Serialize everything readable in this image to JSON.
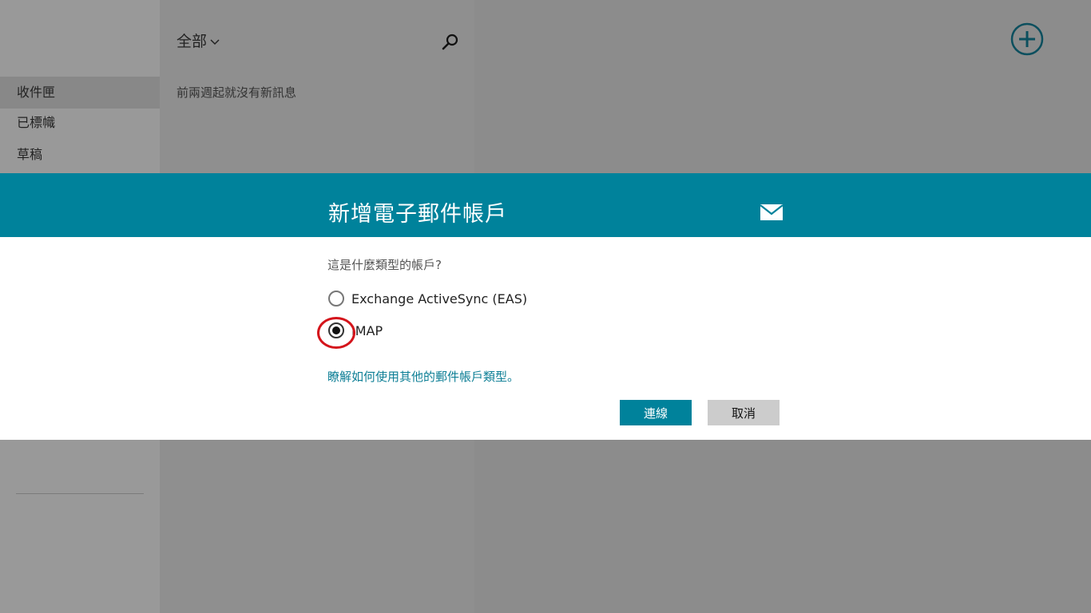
{
  "sidebar": {
    "folders": [
      {
        "label": "收件匣",
        "selected": true
      },
      {
        "label": "已標幟",
        "selected": false
      },
      {
        "label": "草稿",
        "selected": false
      }
    ]
  },
  "message_list": {
    "filter_label": "全部",
    "empty_message": "前兩週起就沒有新訊息"
  },
  "icons": {
    "search": "search-icon",
    "add": "add-icon",
    "mail": "mail-icon",
    "chevron": "chevron-down-icon"
  },
  "dialog": {
    "title": "新增電子郵件帳戶",
    "question": "這是什麼類型的帳戶?",
    "options": [
      {
        "label": "Exchange ActiveSync (EAS)",
        "checked": false
      },
      {
        "label": "IMAP",
        "checked": true
      }
    ],
    "learn_more": "瞭解如何使用其他的郵件帳戶類型。",
    "connect_label": "連線",
    "cancel_label": "取消"
  },
  "colors": {
    "accent": "#00829b",
    "annotation": "#d4141b"
  }
}
